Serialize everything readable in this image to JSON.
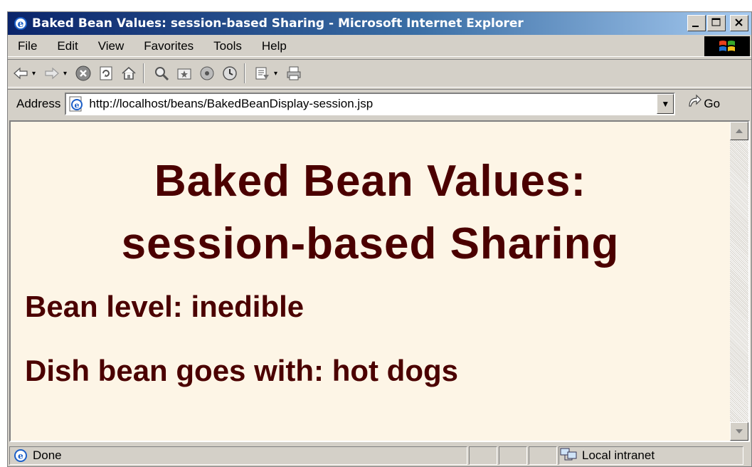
{
  "window": {
    "title": "Baked Bean Values: session-based Sharing - Microsoft Internet Explorer"
  },
  "menu": {
    "items": [
      "File",
      "Edit",
      "View",
      "Favorites",
      "Tools",
      "Help"
    ]
  },
  "toolbar": {
    "buttons": [
      "back-icon",
      "forward-icon",
      "stop-icon",
      "refresh-icon",
      "home-icon",
      "search-icon",
      "favorites-icon",
      "media-icon",
      "history-icon",
      "mail-icon",
      "print-icon"
    ]
  },
  "address": {
    "label": "Address",
    "url": "http://localhost/beans/BakedBeanDisplay-session.jsp",
    "go_label": "Go"
  },
  "page": {
    "heading_line1": "Baked Bean Values:",
    "heading_line2": "session-based Sharing",
    "bean_level": "Bean level: inedible",
    "dish": "Dish bean goes with: hot dogs"
  },
  "status": {
    "text": "Done",
    "zone": "Local intranet"
  },
  "colors": {
    "content_bg": "#fdf5e6",
    "heading_color": "#4b0000",
    "titlebar_start": "#0a246a",
    "titlebar_end": "#a6caf0"
  }
}
